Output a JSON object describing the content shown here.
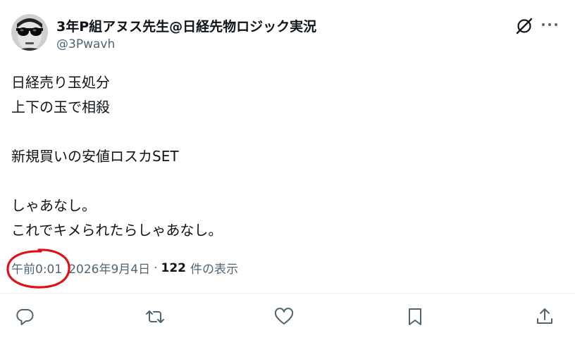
{
  "author": {
    "display_name": "3年P組アヌス先生@日経先物ロジック実況",
    "handle": "@3Pwavh",
    "avatar_icon": "sunglasses-avatar"
  },
  "header_actions": {
    "grok_icon": "grok-icon",
    "more_icon": "more-dots-icon"
  },
  "post": {
    "lines": [
      "日経売り玉処分",
      "上下の玉で相殺",
      "",
      "新規買いの安値ロスカSET",
      "",
      "しゃあなし。",
      "これでキメられたらしゃあなし。"
    ]
  },
  "meta": {
    "time": "午前0:01",
    "separator": "·",
    "date": "2026年9月4日",
    "views_count": "122",
    "views_label": "件の表示",
    "annotation_color": "#e0101b"
  },
  "actions": [
    {
      "icon": "reply-icon"
    },
    {
      "icon": "retweet-icon"
    },
    {
      "icon": "like-icon"
    },
    {
      "icon": "bookmark-icon"
    },
    {
      "icon": "share-icon"
    }
  ],
  "colors": {
    "text_primary": "#0f1419",
    "text_secondary": "#536471",
    "divider": "#eff3f4"
  }
}
